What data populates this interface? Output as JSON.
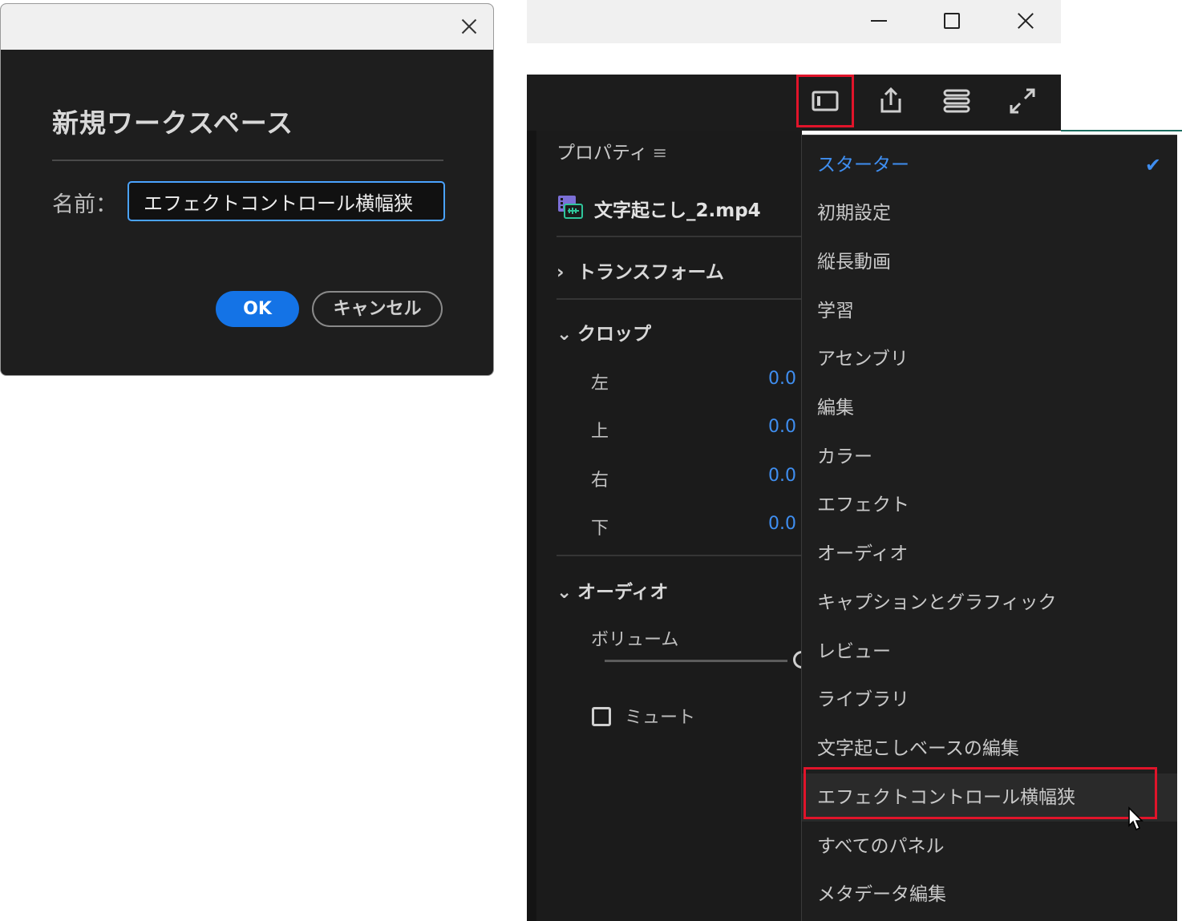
{
  "dialog": {
    "heading": "新規ワークスペース",
    "name_label": "名前：",
    "name_value": "エフェクトコントロール横幅狭",
    "ok_label": "OK",
    "cancel_label": "キャンセル"
  },
  "panel": {
    "title": "プロパティ",
    "menu_glyph": "≡",
    "clip_name": "文字起こし_2.mp4",
    "transform_label": "トランスフォーム",
    "crop_label": "クロップ",
    "crop_rows": [
      {
        "label": "左",
        "value": "0.0"
      },
      {
        "label": "上",
        "value": "0.0"
      },
      {
        "label": "右",
        "value": "0.0"
      },
      {
        "label": "下",
        "value": "0.0"
      }
    ],
    "audio_label": "オーディオ",
    "volume_label": "ボリューム",
    "mute_label": "ミュート"
  },
  "workspace_menu": {
    "items": [
      "スターター",
      "初期設定",
      "縦長動画",
      "学習",
      "アセンブリ",
      "編集",
      "カラー",
      "エフェクト",
      "オーディオ",
      "キャプションとグラフィック",
      "レビュー",
      "ライブラリ",
      "文字起こしベースの編集",
      "エフェクトコントロール横幅狭",
      "すべてのパネル",
      "メタデータ編集"
    ],
    "checked_item": "スターター",
    "hovered_item": "エフェクトコントロール横幅狭"
  },
  "colors": {
    "accent": "#1473e6",
    "value_blue": "#3f8ef0",
    "highlight_red": "#e0142a",
    "panel_bg": "#1b1b1b"
  },
  "icons": [
    "close-icon",
    "minimize-icon",
    "maximize-icon",
    "workspaces-icon",
    "share-icon",
    "panels-icon",
    "fullscreen-icon",
    "video-clip-icon",
    "chevron-right-icon",
    "chevron-down-icon",
    "checkmark-icon",
    "mouse-cursor-icon"
  ]
}
